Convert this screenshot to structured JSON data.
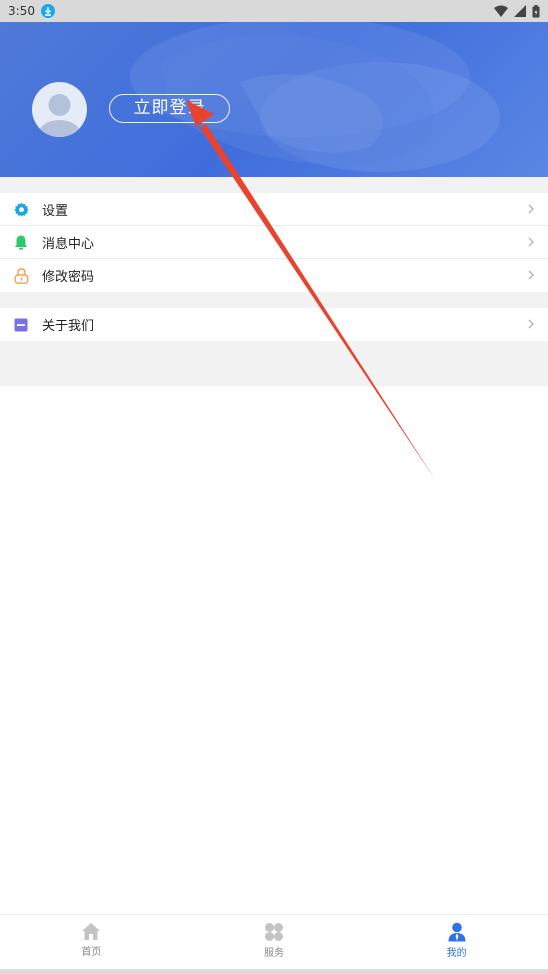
{
  "status_bar": {
    "time": "3:50"
  },
  "header": {
    "login_label": "立即登录"
  },
  "menu_group_1": [
    {
      "label": "设置",
      "icon": "gear-icon",
      "color": "#1ba7e4"
    },
    {
      "label": "消息中心",
      "icon": "bell-icon",
      "color": "#2dc96d"
    },
    {
      "label": "修改密码",
      "icon": "lock-icon",
      "color": "#f5a04a"
    }
  ],
  "menu_group_2": [
    {
      "label": "关于我们",
      "icon": "info-card-icon",
      "color": "#7b6fe6"
    }
  ],
  "tabbar": {
    "tabs": [
      {
        "label": "首页",
        "icon": "home-icon",
        "active": false
      },
      {
        "label": "服务",
        "icon": "grid-icon",
        "active": false
      },
      {
        "label": "我的",
        "icon": "user-icon",
        "active": true
      }
    ]
  },
  "colors": {
    "header_blue": "#4a78de",
    "active_tab": "#2f72e8",
    "annotation_arrow": "#e8432f"
  }
}
